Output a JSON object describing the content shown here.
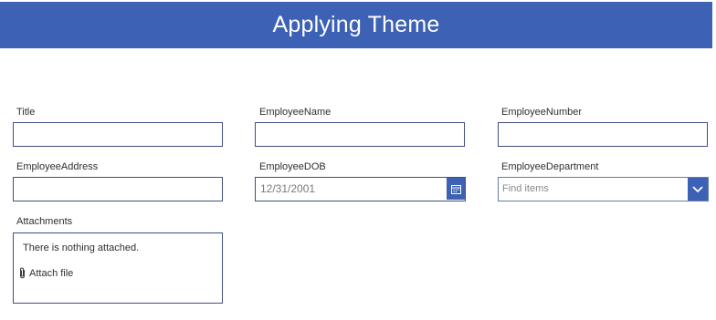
{
  "header": {
    "title": "Applying Theme"
  },
  "form": {
    "title": {
      "label": "Title",
      "value": ""
    },
    "employee_name": {
      "label": "EmployeeName",
      "value": ""
    },
    "employee_number": {
      "label": "EmployeeNumber",
      "value": ""
    },
    "employee_address": {
      "label": "EmployeeAddress",
      "value": ""
    },
    "employee_dob": {
      "label": "EmployeeDOB",
      "value": "12/31/2001",
      "icon": "calendar-icon"
    },
    "employee_department": {
      "label": "EmployeeDepartment",
      "placeholder": "Find items",
      "icon": "chevron-down-icon"
    },
    "attachments": {
      "label": "Attachments",
      "empty_text": "There is nothing attached.",
      "attach_label": "Attach file",
      "icon": "paperclip-icon"
    }
  },
  "colors": {
    "header_bg": "#3d61b4",
    "header_text": "#ffffff",
    "input_border": "#3f4f7f",
    "accent": "#3d61b4"
  }
}
